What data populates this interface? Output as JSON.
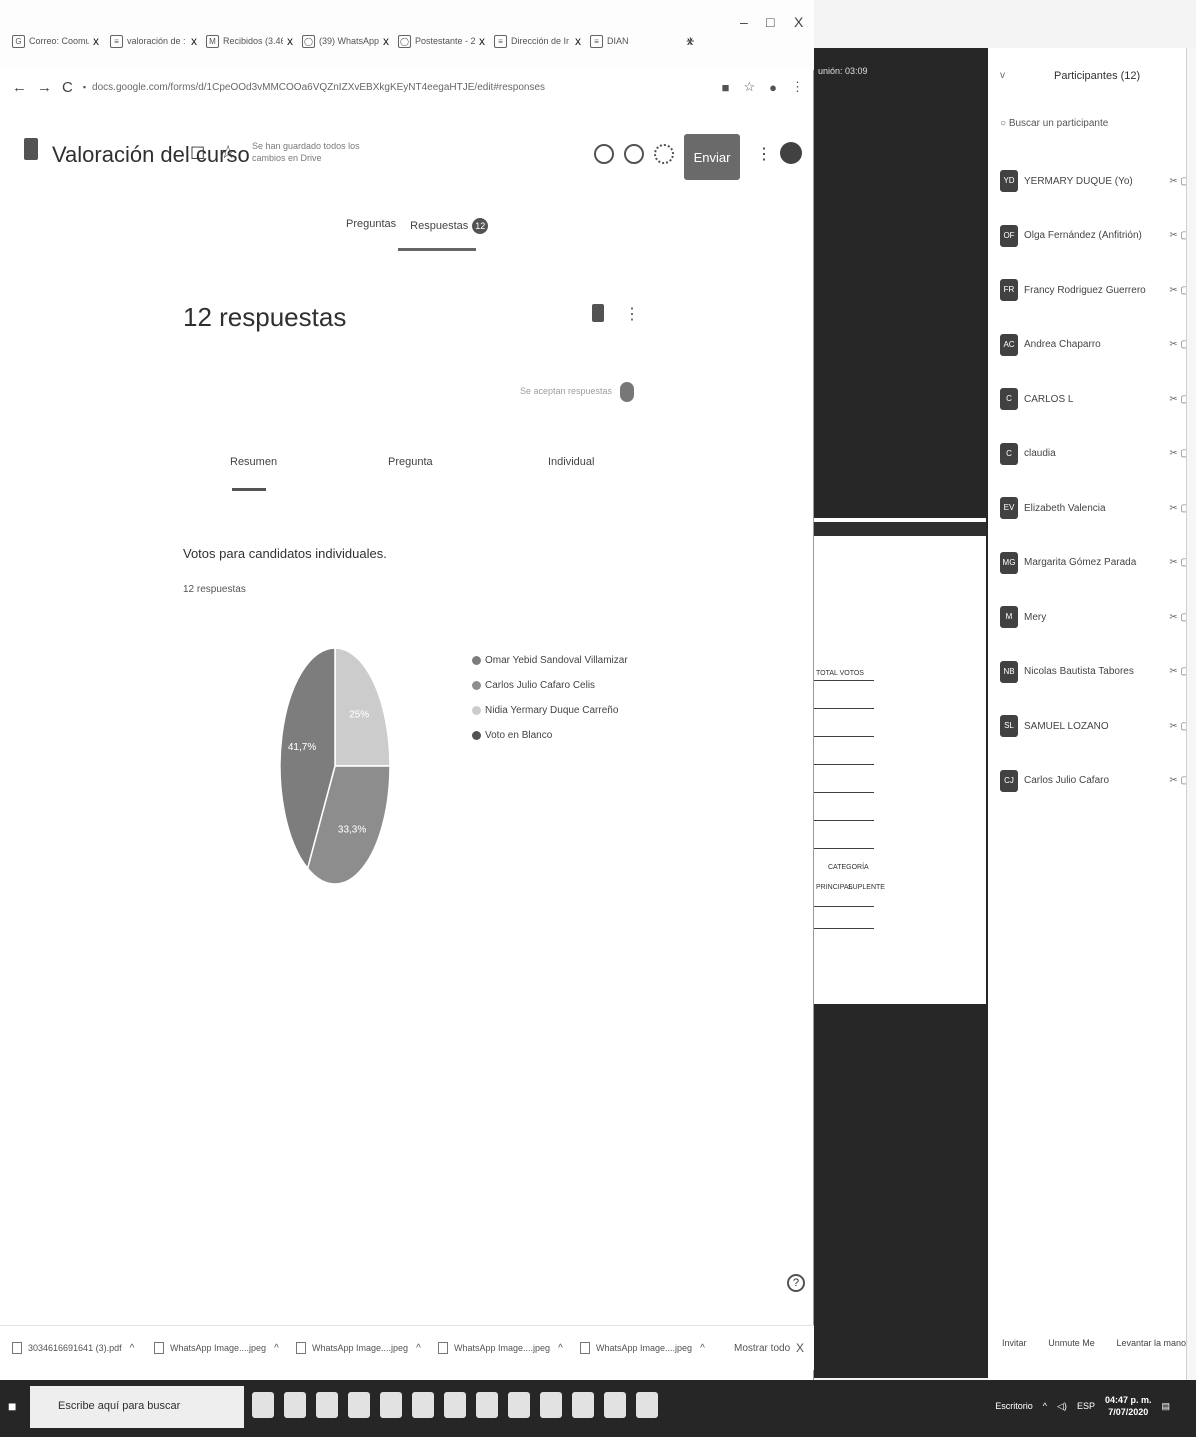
{
  "browser": {
    "tabs": [
      {
        "label": "Correo: Coomu"
      },
      {
        "label": "valoración de :"
      },
      {
        "label": "Recibidos (3.46"
      },
      {
        "label": "(39) WhatsApp"
      },
      {
        "label": "Postestante - 2"
      },
      {
        "label": "Dirección de Ir"
      },
      {
        "label": "DIAN"
      }
    ],
    "url": "docs.google.com/forms/d/1CpeOOd3vMMCOOa6VQZnIZXvEBXkgKEyNT4eegaHTJE/edit#responses"
  },
  "form": {
    "title": "Valoración del curso",
    "saved_note": "Se han guardado todos los cambios en Drive",
    "send_label": "Enviar",
    "tab_questions": "Preguntas",
    "tab_responses": "Respuestas",
    "responses_badge": "12",
    "response_count_title": "12 respuestas",
    "accepting_label": "Se aceptan respuestas",
    "subtab_summary": "Resumen",
    "subtab_question": "Pregunta",
    "subtab_individual": "Individual",
    "question_title": "Votos para candidatos individuales.",
    "question_subtitle": "12 respuestas"
  },
  "chart_data": {
    "type": "pie",
    "labels": [
      "Omar Yebid Sandoval Villamizar",
      "Carlos Julio Cafaro Celis",
      "Nidia Yermary Duque Carreño",
      "Voto en Blanco"
    ],
    "values": [
      41.7,
      33.3,
      25,
      0
    ],
    "slice_labels": [
      "41,7%",
      "33,3%",
      "25%",
      ""
    ],
    "colors": [
      "#7d7d7d",
      "#8c8c8c",
      "#c8c8c8",
      "#555555"
    ]
  },
  "downloads": [
    {
      "name": "3034616691641 (3).pdf"
    },
    {
      "name": "WhatsApp Image....jpeg"
    },
    {
      "name": "WhatsApp Image....jpeg"
    },
    {
      "name": "WhatsApp Image....jpeg"
    },
    {
      "name": "WhatsApp Image....jpeg"
    }
  ],
  "downloads_show_all": "Mostrar todo",
  "meeting": {
    "timer": "unión: 03:09",
    "sheet_header": "TOTAL VOTOS",
    "sheet_cat": "CATEGORÍA",
    "sheet_col1": "PRINCIPAL",
    "sheet_col2": "SUPLENTE"
  },
  "participants": {
    "title": "Participantes (12)",
    "search_placeholder": "Buscar un participante",
    "list": [
      {
        "initials": "YD",
        "name": "YERMARY DUQUE (Yo)"
      },
      {
        "initials": "OF",
        "name": "Olga Fernández (Anfitrión)"
      },
      {
        "initials": "FR",
        "name": "Francy Rodriguez Guerrero"
      },
      {
        "initials": "AC",
        "name": "Andrea Chaparro"
      },
      {
        "initials": "C",
        "name": "CARLOS L"
      },
      {
        "initials": "C",
        "name": "claudia"
      },
      {
        "initials": "EV",
        "name": "Elizabeth Valencia"
      },
      {
        "initials": "MG",
        "name": "Margarita Gómez Parada"
      },
      {
        "initials": "M",
        "name": "Mery"
      },
      {
        "initials": "NB",
        "name": "Nicolas Bautista Tabores"
      },
      {
        "initials": "SL",
        "name": "SAMUEL LOZANO"
      },
      {
        "initials": "CJ",
        "name": "Carlos Julio Cafaro"
      }
    ],
    "invite": "Invitar",
    "unmute": "Unmute Me",
    "raise_hand": "Levantar la mano"
  },
  "taskbar": {
    "search_text": "Escribe aquí para buscar",
    "desktop": "Escritorio",
    "lang": "ESP",
    "time": "04:47 p. m.",
    "date": "7/07/2020"
  }
}
